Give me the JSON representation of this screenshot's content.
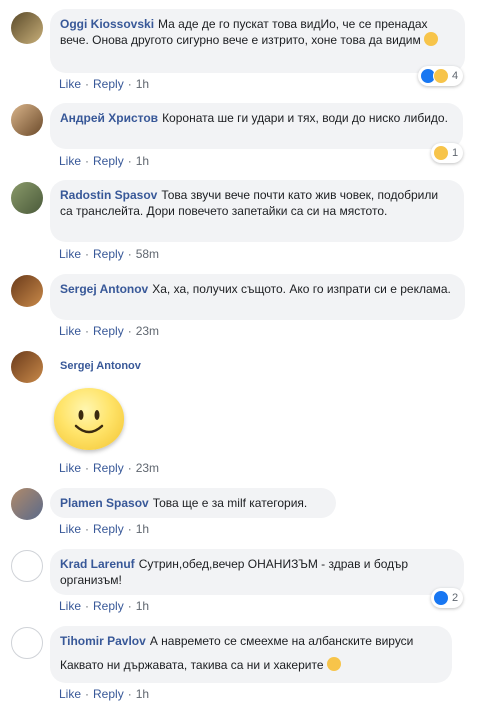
{
  "labels": {
    "like": "Like",
    "reply": "Reply",
    "dot": "·"
  },
  "comments": [
    {
      "author": "Oggi Kiossovski",
      "text": "Ма аде де го пускат това видИо, че се пренадах вече. Онова другото сигурно вече е изтрито, хоне това да видим",
      "emoji": "smirk-emoji",
      "time": "1h",
      "reactions": {
        "icons": [
          "like-icon",
          "haha-icon"
        ],
        "count": "4"
      }
    },
    {
      "author": "Андрей Христов",
      "text": "Короната ше ги удари и тях, води до ниско либидо.",
      "time": "1h",
      "reactions": {
        "icons": [
          "haha-icon"
        ],
        "count": "1"
      }
    },
    {
      "author": "Radostin Spasov",
      "text": "Това звучи вече почти като жив човек, подобрили са транслейта. Дори повечето запетайки са си на мястото.",
      "time": "58m"
    },
    {
      "author": "Sergej Antonov",
      "text": "Ха, ха, получих същото. Ако го изпрати си е реклама.",
      "time": "23m"
    },
    {
      "author": "Sergej Antonov",
      "sticker": "smiley-sticker",
      "time": "23m"
    },
    {
      "author": "Plamen Spasov",
      "text": "Това ще е за milf категория.",
      "time": "1h"
    },
    {
      "author": "Krad Larenuf",
      "text": "Сутрин,обед,вечер ОНАНИЗЪМ - здрав и бодър организъм!",
      "time": "1h",
      "reactions": {
        "icons": [
          "like-icon"
        ],
        "count": "2"
      }
    },
    {
      "author": "Tihomir Pavlov",
      "text": "А навремето се смеехме на албанските вируси",
      "text2": "Каквато ни държавата, такива са ни и хакерите",
      "emoji": "grin-emoji",
      "time": "1h"
    }
  ]
}
